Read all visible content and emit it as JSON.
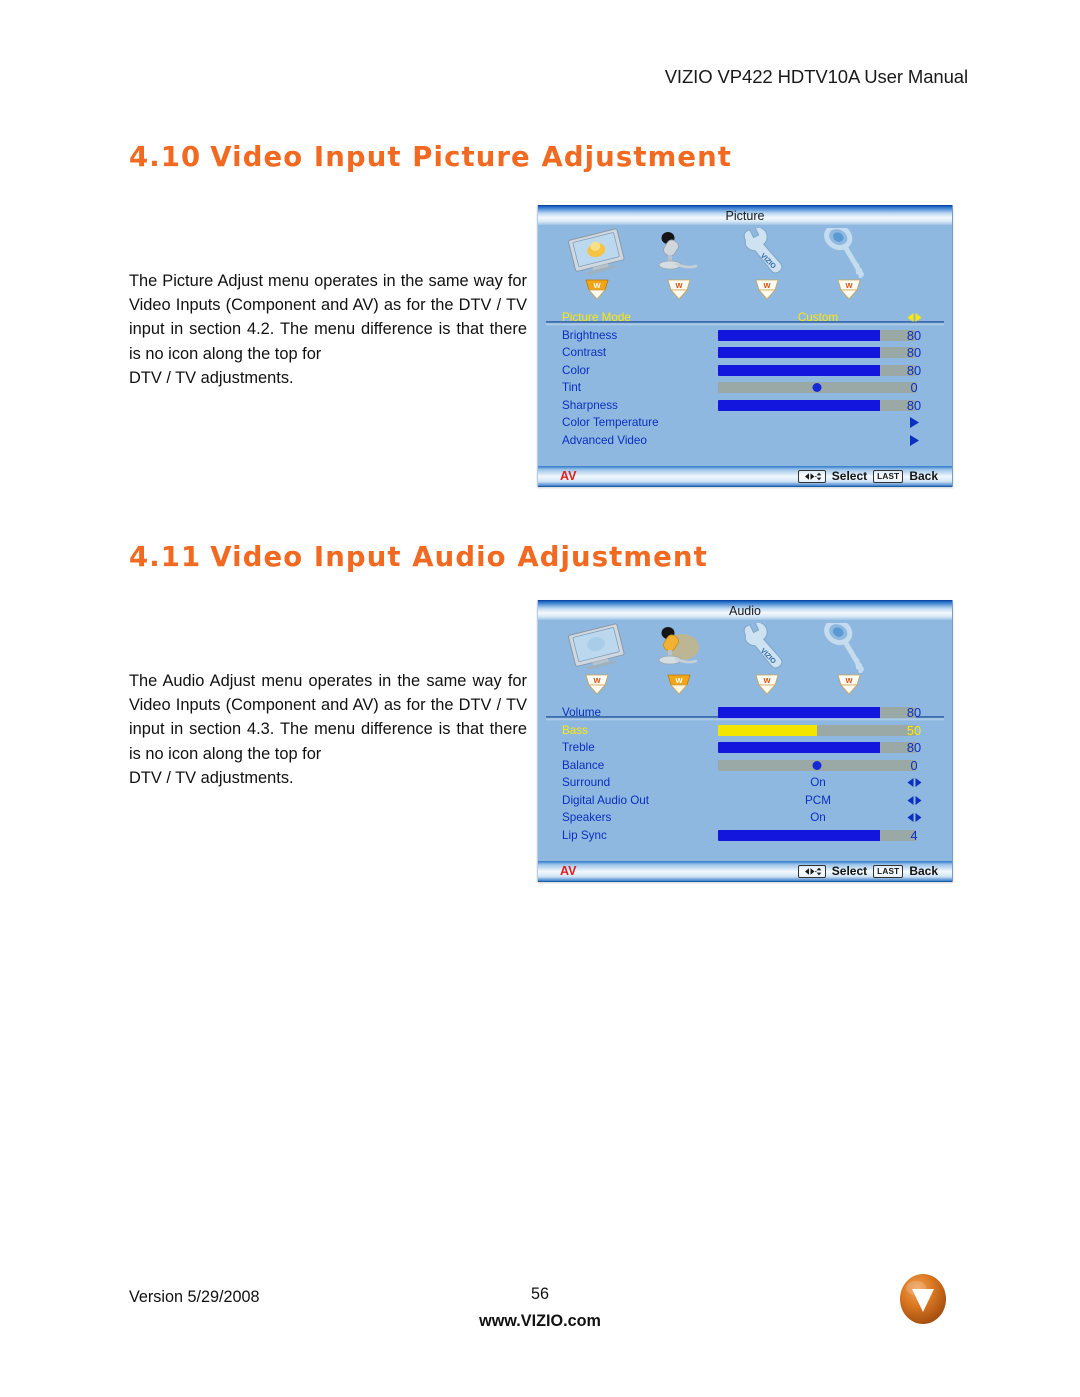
{
  "page": {
    "header": "VIZIO VP422 HDTV10A User Manual",
    "version": "Version 5/29/2008",
    "page_number": "56",
    "website": "www.VIZIO.com",
    "logo_letter": "V",
    "brand_color": "#D9731E",
    "heading_color": "#F26A21"
  },
  "sections": [
    {
      "number": "4.10",
      "title": "Video Input Picture Adjustment",
      "paragraph": "The Picture Adjust menu operates in the same way for Video Inputs (Component and AV) as for the DTV / TV input in section 4.2.  The menu difference is that there is no icon along the top for",
      "paragraph_tail": "DTV / TV adjustments."
    },
    {
      "number": "4.11",
      "title": "Video Input Audio Adjustment",
      "paragraph": "The Audio Adjust menu operates in the same way for Video Inputs (Component and AV) as for the DTV / TV input in section 4.3.  The menu difference is that there is no icon along the top for",
      "paragraph_tail": "DTV / TV adjustments."
    }
  ],
  "osd_picture": {
    "title": "Picture",
    "icons": [
      {
        "name": "picture-icon",
        "label": "Picture",
        "active": true
      },
      {
        "name": "audio-icon",
        "label": "Audio",
        "active": false
      },
      {
        "name": "setup-icon",
        "label": "Setup",
        "active": false
      },
      {
        "name": "parental-icon",
        "label": "Parental",
        "active": false
      }
    ],
    "rows": [
      {
        "label": "Picture Mode",
        "type": "option",
        "value": "Custom",
        "selected": true,
        "indicator": "left-right"
      },
      {
        "label": "Brightness",
        "type": "slider",
        "value": "80",
        "percent": 82,
        "selected": false
      },
      {
        "label": "Contrast",
        "type": "slider",
        "value": "80",
        "percent": 82,
        "selected": false
      },
      {
        "label": "Color",
        "type": "slider",
        "value": "80",
        "percent": 82,
        "selected": false
      },
      {
        "label": "Tint",
        "type": "center",
        "value": "0",
        "percent": 50,
        "selected": false
      },
      {
        "label": "Sharpness",
        "type": "slider",
        "value": "80",
        "percent": 82,
        "selected": false
      },
      {
        "label": "Color Temperature",
        "type": "submenu",
        "value": "",
        "selected": false,
        "indicator": "right"
      },
      {
        "label": "Advanced Video",
        "type": "submenu",
        "value": "",
        "selected": false,
        "indicator": "right"
      }
    ],
    "bottom": {
      "input": "AV",
      "select_label": "Select",
      "back_key": "LAST",
      "back_label": "Back"
    }
  },
  "osd_audio": {
    "title": "Audio",
    "icons": [
      {
        "name": "picture-icon",
        "label": "Picture",
        "active": false
      },
      {
        "name": "audio-icon",
        "label": "Audio",
        "active": true
      },
      {
        "name": "setup-icon",
        "label": "Setup",
        "active": false
      },
      {
        "name": "parental-icon",
        "label": "Parental",
        "active": false
      }
    ],
    "rows": [
      {
        "label": "Volume",
        "type": "slider",
        "value": "80",
        "percent": 82,
        "selected": false
      },
      {
        "label": "Bass",
        "type": "slider",
        "value": "50",
        "percent": 50,
        "selected": true
      },
      {
        "label": "Treble",
        "type": "slider",
        "value": "80",
        "percent": 82,
        "selected": false
      },
      {
        "label": "Balance",
        "type": "center",
        "value": "0",
        "percent": 50,
        "selected": false
      },
      {
        "label": "Surround",
        "type": "option",
        "value": "On",
        "selected": false,
        "indicator": "left-right"
      },
      {
        "label": "Digital Audio Out",
        "type": "option",
        "value": "PCM",
        "selected": false,
        "indicator": "left-right"
      },
      {
        "label": "Speakers",
        "type": "option",
        "value": "On",
        "selected": false,
        "indicator": "left-right"
      },
      {
        "label": "Lip Sync",
        "type": "slider",
        "value": "4",
        "percent": 82,
        "selected": false
      }
    ],
    "bottom": {
      "input": "AV",
      "select_label": "Select",
      "back_key": "LAST",
      "back_label": "Back"
    }
  }
}
